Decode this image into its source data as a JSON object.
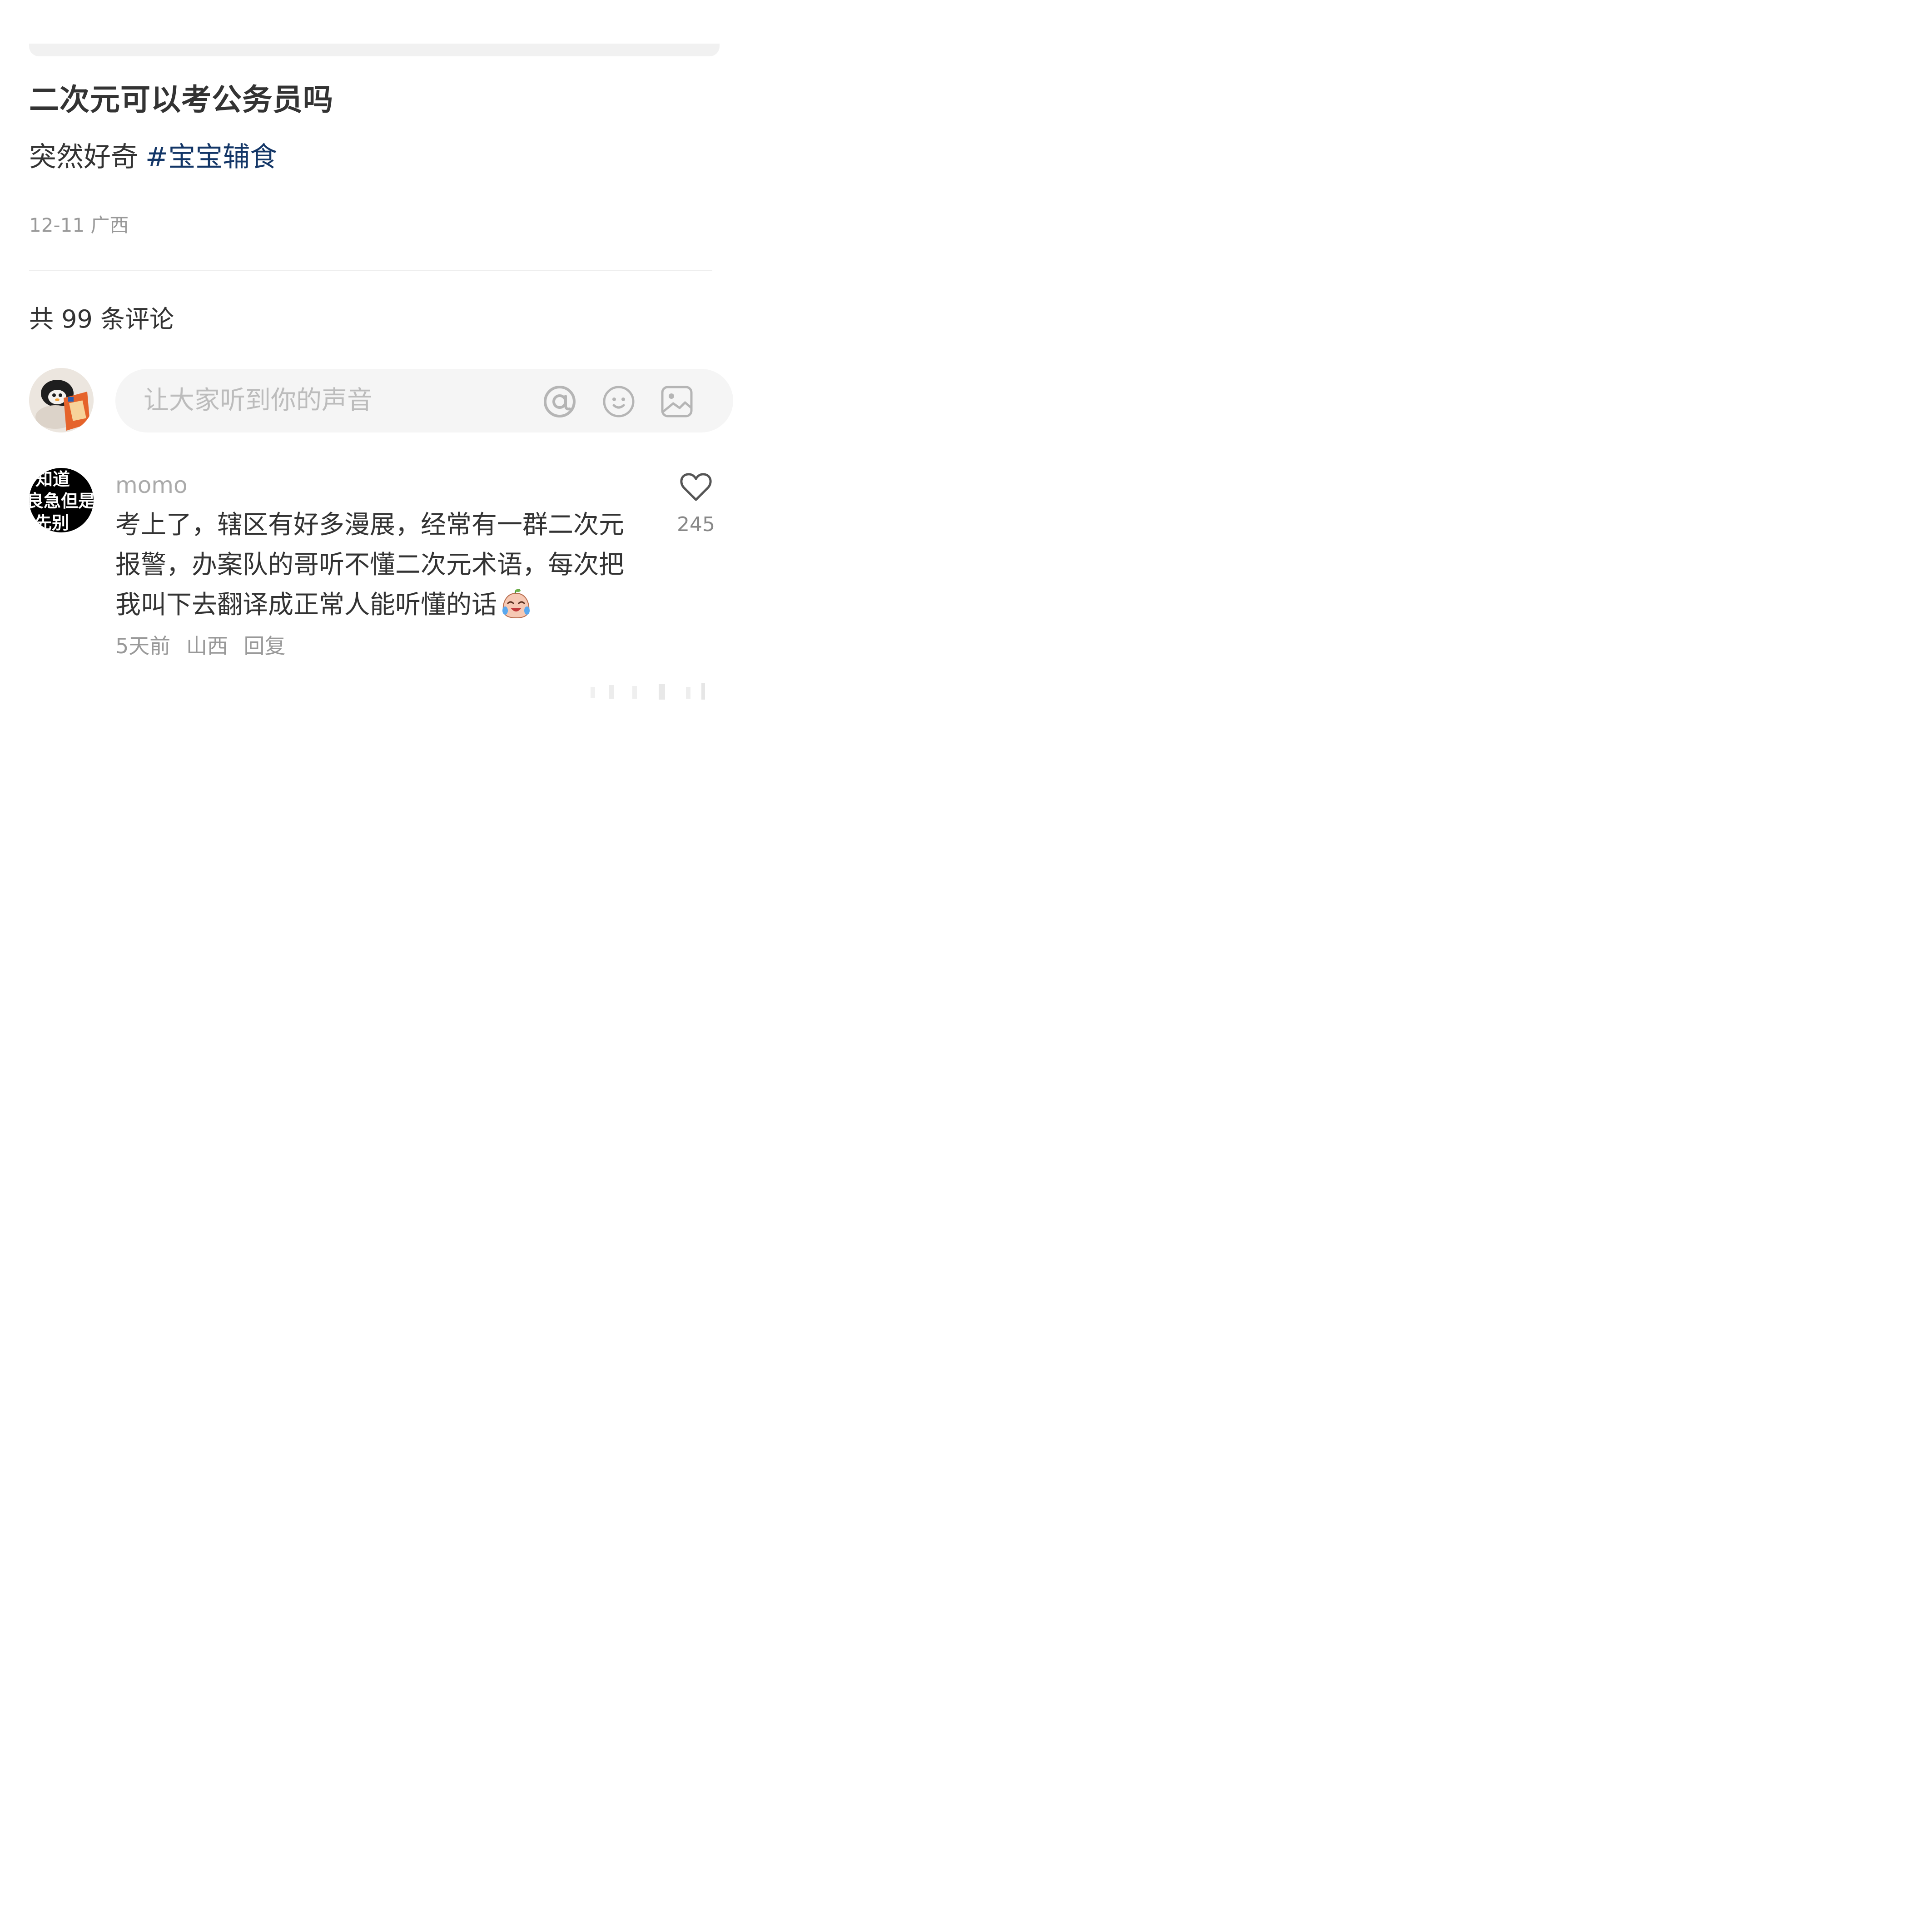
{
  "post": {
    "title": "二次元可以考公务员吗",
    "body_text": "突然好奇",
    "hashtag": "#宝宝辅食",
    "date": "12-11",
    "location": "广西"
  },
  "comments_section": {
    "count_label": "共 99 条评论",
    "input_placeholder": "让大家听到你的声音",
    "icons": [
      "at-icon",
      "emoji-icon",
      "image-icon"
    ]
  },
  "comments": [
    {
      "author": "momo",
      "avatar_text": [
        "知道",
        "良急但是",
        "先别"
      ],
      "text_lines": [
        "考上了，辖区有好多漫展，经常有一群二次元",
        "报警，办案队的哥听不懂二次元术语，每次把",
        "我叫下去翻译成正常人能听懂的话"
      ],
      "emoji": "crying-laughing-face",
      "time": "5天前",
      "location": "山西",
      "reply_label": "回复",
      "like_count": "245"
    }
  ],
  "colors": {
    "hashtag": "#133667",
    "muted_text": "#999999",
    "input_bg": "#f5f5f5"
  }
}
